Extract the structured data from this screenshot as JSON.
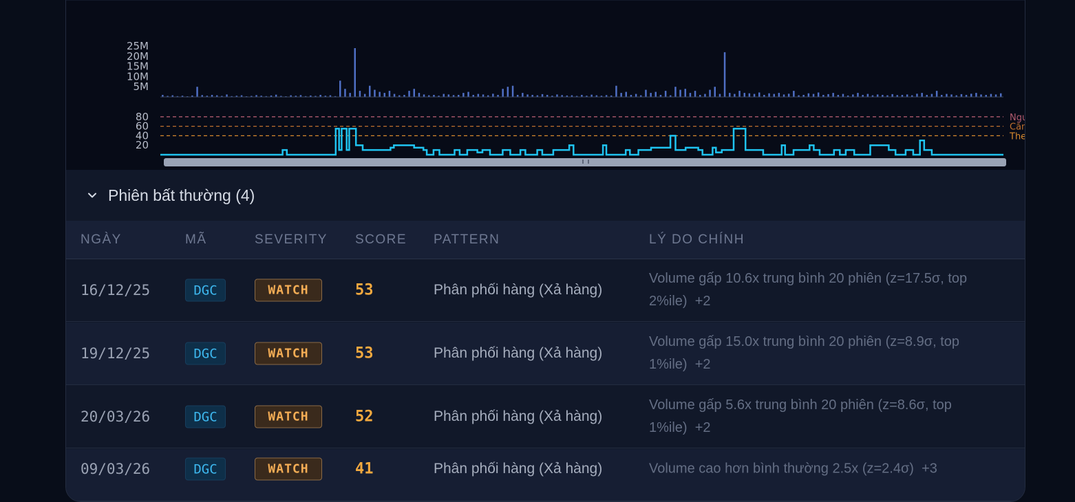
{
  "chart_data": [
    {
      "type": "bar",
      "ylabel": "",
      "y_ticks": [
        "25M",
        "20M",
        "15M",
        "10M",
        "5M"
      ],
      "ylim": [
        0,
        28000000
      ],
      "values_millions": [
        1,
        0.5,
        0.8,
        0.4,
        0.6,
        0.3,
        0.7,
        5,
        0.9,
        0.6,
        1,
        0.8,
        0.5,
        1.2,
        0.4,
        0.6,
        0.8,
        0.3,
        0.5,
        0.9,
        0.6,
        0.4,
        0.7,
        1.1,
        0.5,
        0.3,
        0.8,
        0.6,
        0.9,
        0.4,
        0.7,
        0.5,
        1,
        0.6,
        0.8,
        0.4,
        8,
        4,
        2,
        24,
        3,
        1.5,
        5.5,
        3.5,
        2.5,
        2,
        3,
        1.5,
        0.8,
        1,
        3,
        4,
        2,
        1.2,
        0.8,
        1,
        0.6,
        1.5,
        1.2,
        0.9,
        1,
        2,
        2.5,
        1,
        1.5,
        1.2,
        0.8,
        1.6,
        1,
        4,
        5,
        5.5,
        1,
        2,
        1.2,
        1,
        0.8,
        1.4,
        1,
        0.6,
        1.2,
        0.9,
        0.7,
        0.8,
        0.5,
        1,
        0.6,
        1.1,
        0.8,
        0.6,
        0.9,
        0.7,
        5.5,
        2,
        2.5,
        1,
        1.5,
        0.8,
        3.5,
        2,
        2.5,
        1,
        3,
        0.8,
        5,
        3.5,
        4,
        2,
        3,
        1,
        1.5,
        3.5,
        5,
        1.5,
        22,
        2,
        1.5,
        3,
        2,
        1.8,
        1.5,
        2.2,
        1,
        1.8,
        1.5,
        2,
        1.2,
        1.6,
        3,
        0.8,
        1,
        1.8,
        1.5,
        2.2,
        1,
        1.4,
        2,
        1,
        1.5,
        0.7,
        1.2,
        2,
        1,
        1.5,
        0.8,
        1.2,
        1,
        0.8,
        1.4,
        0.9,
        1,
        1.2,
        0.8,
        1.6,
        2,
        1,
        1.5,
        3,
        1,
        1.5,
        1.2,
        0.8,
        1.4,
        1,
        1.6,
        2,
        1.2,
        1,
        1.5,
        1.2,
        1.8
      ]
    },
    {
      "type": "line",
      "y_ticks": [
        "80",
        "60",
        "40",
        "20"
      ],
      "ylim": [
        0,
        90
      ],
      "threshold_lines": [
        {
          "value": 80,
          "label": "Ngu",
          "color": "#b05a6e"
        },
        {
          "value": 60,
          "label": "Căn",
          "color": "#c0702e"
        },
        {
          "value": 40,
          "label": "The",
          "color": "#d88a2e"
        }
      ],
      "series_steps": [
        [
          0,
          0
        ],
        [
          14.5,
          10
        ],
        [
          15,
          0
        ],
        [
          20.8,
          55
        ],
        [
          21.2,
          10
        ],
        [
          21.5,
          55
        ],
        [
          22.1,
          10
        ],
        [
          22.4,
          55
        ],
        [
          23.2,
          20
        ],
        [
          24,
          10
        ],
        [
          27.3,
          15
        ],
        [
          27.7,
          20
        ],
        [
          30.1,
          15
        ],
        [
          31.2,
          10
        ],
        [
          31.6,
          0
        ],
        [
          32.4,
          10
        ],
        [
          33.1,
          0
        ],
        [
          34.9,
          10
        ],
        [
          35.5,
          0
        ],
        [
          36.4,
          10
        ],
        [
          37.6,
          5
        ],
        [
          38.2,
          10
        ],
        [
          39.1,
          0
        ],
        [
          40.6,
          10
        ],
        [
          41.5,
          0
        ],
        [
          42.7,
          10
        ],
        [
          43.3,
          0
        ],
        [
          44.7,
          10
        ],
        [
          45.3,
          0
        ],
        [
          46.6,
          10
        ],
        [
          48.5,
          20
        ],
        [
          49,
          0
        ],
        [
          52.5,
          20
        ],
        [
          52.9,
          0
        ],
        [
          55.2,
          10
        ],
        [
          55.7,
          0
        ],
        [
          56.7,
          10
        ],
        [
          58.2,
          15
        ],
        [
          60.5,
          40
        ],
        [
          61.1,
          10
        ],
        [
          62.3,
          15
        ],
        [
          63.8,
          10
        ],
        [
          64.3,
          0
        ],
        [
          65.5,
          15
        ],
        [
          65.9,
          5
        ],
        [
          66.6,
          10
        ],
        [
          68,
          55
        ],
        [
          69.4,
          10
        ],
        [
          70.9,
          10
        ],
        [
          71.5,
          0
        ],
        [
          73.7,
          20
        ],
        [
          74.1,
          0
        ],
        [
          75.1,
          10
        ],
        [
          77,
          20
        ],
        [
          77.5,
          10
        ],
        [
          78.2,
          0
        ],
        [
          79.9,
          10
        ],
        [
          80.6,
          0
        ],
        [
          81.3,
          10
        ],
        [
          82.3,
          0
        ],
        [
          84.2,
          20
        ],
        [
          86.4,
          10
        ],
        [
          87.2,
          0
        ],
        [
          88.4,
          10
        ],
        [
          89.3,
          0
        ],
        [
          90.1,
          30
        ],
        [
          90.6,
          10
        ],
        [
          91.5,
          0
        ],
        [
          99.9,
          0
        ]
      ],
      "xlim": [
        0,
        100
      ]
    }
  ],
  "section": {
    "title": "Phiên bất thường (4)",
    "chevron_icon": "chevron-down-icon"
  },
  "table": {
    "headers": {
      "date": "NGÀY",
      "ticker": "MÃ",
      "severity": "SEVERITY",
      "score": "SCORE",
      "pattern": "PATTERN",
      "reason": "LÝ DO CHÍNH"
    },
    "rows": [
      {
        "date": "16/12/25",
        "ticker": "DGC",
        "severity": "WATCH",
        "score": "53",
        "pattern": "Phân phối hàng (Xả hàng)",
        "reason": "Volume gấp 10.6x trung bình 20 phiên (z=17.5σ, top 2%ile)",
        "more": "+2"
      },
      {
        "date": "19/12/25",
        "ticker": "DGC",
        "severity": "WATCH",
        "score": "53",
        "pattern": "Phân phối hàng (Xả hàng)",
        "reason": "Volume gấp 15.0x trung bình 20 phiên (z=8.9σ, top 1%ile)",
        "more": "+2"
      },
      {
        "date": "20/03/26",
        "ticker": "DGC",
        "severity": "WATCH",
        "score": "52",
        "pattern": "Phân phối hàng (Xả hàng)",
        "reason": "Volume gấp 5.6x trung bình 20 phiên (z=8.6σ, top 1%ile)",
        "more": "+2"
      },
      {
        "date": "09/03/26",
        "ticker": "DGC",
        "severity": "WATCH",
        "score": "41",
        "pattern": "Phân phối hàng (Xả hàng)",
        "reason": "Volume cao hơn bình thường 2.5x (z=2.4σ)",
        "more": "+3"
      }
    ]
  },
  "colors": {
    "volume_bar": "#4f6fc4",
    "score_line": "#1fc3f0",
    "severity_watch": "#f4ad55"
  }
}
